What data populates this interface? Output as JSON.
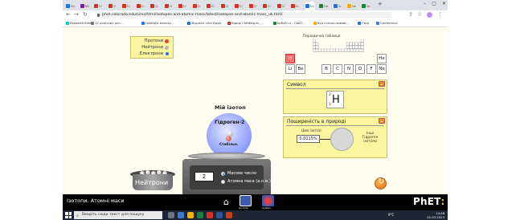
{
  "browser": {
    "tabs": [
      {
        "label": "Sci",
        "color": "#1a73e8"
      },
      {
        "label": "RD",
        "color": "#7a1fa2"
      },
      {
        "label": "Cl",
        "color": "#d93025"
      },
      {
        "label": "Cl",
        "color": "#d93025"
      },
      {
        "label": "Cl",
        "color": "#d93025"
      },
      {
        "label": "Cl",
        "color": "#d93025"
      },
      {
        "label": "Cl",
        "color": "#d93025"
      },
      {
        "label": "Cl",
        "color": "#d93025"
      },
      {
        "label": "Cl",
        "color": "#d93025"
      },
      {
        "label": "Cl",
        "color": "#d93025"
      },
      {
        "label": "Cl",
        "color": "#d93025"
      },
      {
        "label": "Cl",
        "color": "#d93025"
      },
      {
        "label": "Cl",
        "color": "#d93025"
      },
      {
        "label": "Cl",
        "color": "#d93025"
      },
      {
        "label": "Cl",
        "color": "#d93025"
      },
      {
        "label": "Cl",
        "color": "#d93025"
      },
      {
        "label": "Cl",
        "color": "#d93025"
      },
      {
        "label": "Sci",
        "color": "#1a73e8"
      },
      {
        "label": "Go",
        "color": "#188038"
      },
      {
        "label": "Sc",
        "color": "#1a73e8"
      },
      {
        "label": "He",
        "color": "#f9ab00"
      },
      {
        "label": "Go",
        "color": "#188038"
      }
    ],
    "url": "phet.colorado.edu/sims/html/isotopes-and-atomic-mass/latest/isotopes-and-atomic-mass_uk.html",
    "bookmarks": [
      {
        "label": "ResearchGate",
        "color": "#00ccbb"
      },
      {
        "label": "12 конічних рез...",
        "color": "#777777"
      },
      {
        "label": "Ізомерія молеку...",
        "color": "#1a73e8"
      },
      {
        "label": "Журнал «Hel Кром",
        "color": "#1a73e8"
      },
      {
        "label": "Відкрі і безбедлн_...",
        "color": "#d93025"
      },
      {
        "label": "KoRoR.ru - САЙТ...",
        "color": "#188038"
      },
      {
        "label": "Все статьи химии...",
        "color": "#f9ab00"
      },
      {
        "label": "Chrg",
        "color": "#1a73e8"
      },
      {
        "label": "Conference",
        "color": "#3d7bd8"
      }
    ]
  },
  "legend": {
    "protons": {
      "label": "Протони",
      "color": "#e8412c"
    },
    "neutrons": {
      "label": "Нейтрони",
      "color": "#b8b8b8"
    },
    "electrons": {
      "label": "Електрони",
      "color": "#2b6be0"
    }
  },
  "periodic_table": {
    "title": "Періодична таблиця",
    "cells": [
      "H",
      "He",
      "Li",
      "Be",
      "B",
      "C",
      "N",
      "O",
      "F",
      "Ne"
    ],
    "selected": "H"
  },
  "symbol": {
    "header": "Символ",
    "element": "H",
    "mass_number": "2",
    "atomic_number": "1"
  },
  "abundance": {
    "header": "Поширеність в природі",
    "this_isotope_label": "Цей ізотоп",
    "value": "0.0115%",
    "other_label": "Інші Гідроген ізотопи"
  },
  "isotope": {
    "title": "Мій ізотоп",
    "name": "Гідроген-2",
    "stability": "Стабільн."
  },
  "scale": {
    "readout": "2",
    "option_mass": "Масове число",
    "option_atomic": "Атомна маса (а.о.м.)",
    "selected": "mass"
  },
  "bucket": {
    "label": "Нейтрони"
  },
  "navbar": {
    "title": "Ізотопи. Атомні маси",
    "screen1": "Ізотопи",
    "screen2": "Суміші",
    "logo_main": "PhET",
    "logo_suffix": ":"
  },
  "taskbar": {
    "search_placeholder": "Введіть сюди текст для пошуку",
    "temp": "9°C",
    "time": "14:48",
    "date": "22.03.2023"
  }
}
